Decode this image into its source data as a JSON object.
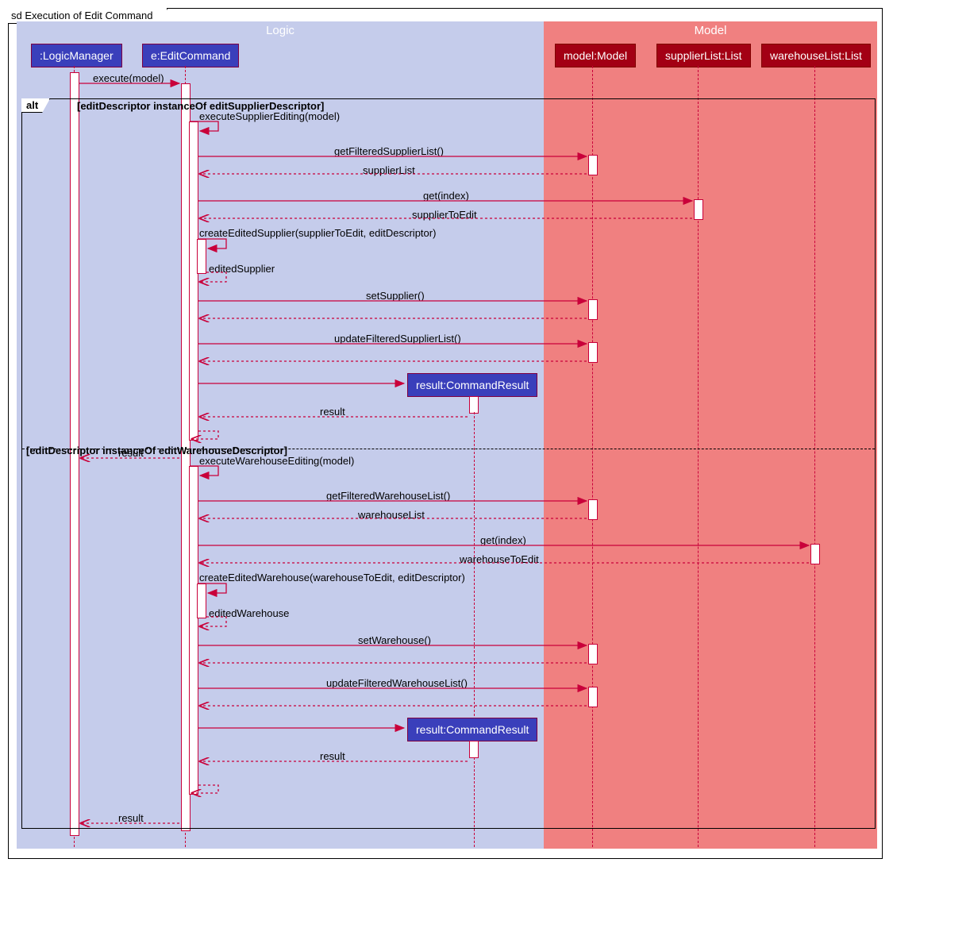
{
  "title": "sd Execution of Edit Command",
  "packages": {
    "logic": "Logic",
    "model": "Model"
  },
  "participants": {
    "logicManager": ":LogicManager",
    "editCommand": "e:EditCommand",
    "model": "model:Model",
    "supplierList": "supplierList:List",
    "warehouseList": "warehouseList:List",
    "commandResult1": "result:CommandResult",
    "commandResult2": "result:CommandResult"
  },
  "alt": {
    "label": "alt",
    "guard1": "[editDescriptor instanceOf editSupplierDescriptor]",
    "guard2": "[editDescriptor instanceOf editWarehouseDescriptor]"
  },
  "messages": {
    "execute": "execute(model)",
    "executeSupplier": "executeSupplierEditing(model)",
    "getFilteredSupplier": "getFilteredSupplierList()",
    "supplierListRet": "supplierList",
    "getIndex1": "get(index)",
    "supplierToEdit": "supplierToEdit",
    "createEditedSupplier": "createEditedSupplier(supplierToEdit, editDescriptor)",
    "editedSupplier": "editedSupplier",
    "setSupplier": "setSupplier()",
    "updateFilteredSupplier": "updateFilteredSupplierList()",
    "result1": "result",
    "result1b": "result",
    "executeWarehouse": "executeWarehouseEditing(model)",
    "getFilteredWarehouse": "getFilteredWarehouseList()",
    "warehouseListRet": "warehouseList",
    "getIndex2": "get(index)",
    "warehouseToEdit": "warehouseToEdit",
    "createEditedWarehouse": "createEditedWarehouse(warehouseToEdit, editDescriptor)",
    "editedWarehouse": "editedWarehouse",
    "setWarehouse": "setWarehouse()",
    "updateFilteredWarehouse": "updateFilteredWarehouseList()",
    "result2": "result",
    "result2b": "result"
  }
}
